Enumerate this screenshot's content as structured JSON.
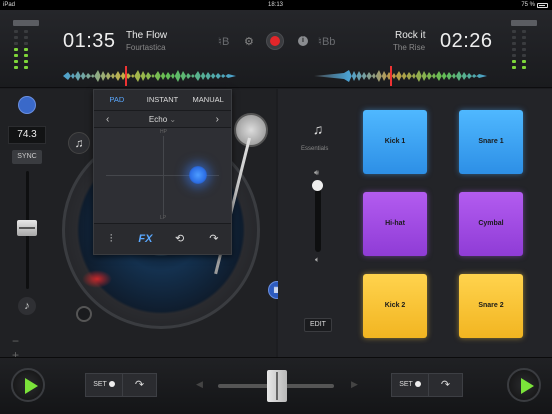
{
  "status": {
    "device": "iPad",
    "time": "18:13",
    "battery": "75 %"
  },
  "deck_a": {
    "time": "01:35",
    "title": "The Flow",
    "artist": "Fourtastica",
    "key": "B",
    "bpm": "74.3",
    "sync_label": "SYNC",
    "minus": "−",
    "plus": "+"
  },
  "deck_b": {
    "time": "02:26",
    "title": "Rock it",
    "artist": "The Rise",
    "key": "Bb"
  },
  "fx": {
    "tabs": [
      "PAD",
      "INSTANT",
      "MANUAL"
    ],
    "active_tab": "PAD",
    "effect": "Echo",
    "hp_label": "HP",
    "lp_label": "LP",
    "fx_label": "FX",
    "x_pos": 0.74,
    "y_pos": 0.5
  },
  "sampler": {
    "pack": "Essentials",
    "edit_label": "EDIT",
    "pads": [
      {
        "label": "Kick 1",
        "color": "#3fa9f5"
      },
      {
        "label": "Snare 1",
        "color": "#3fa9f5"
      },
      {
        "label": "Hi-hat",
        "color": "#a64fe8"
      },
      {
        "label": "Cymbal",
        "color": "#a64fe8"
      },
      {
        "label": "Kick 2",
        "color": "#fcc93a"
      },
      {
        "label": "Snare 2",
        "color": "#fcc93a"
      }
    ],
    "volume": 0.95
  },
  "bottom": {
    "set_left": "SET",
    "set_right": "SET",
    "crossfader": 0.5
  },
  "colors": {
    "accent": "#5aa8ff",
    "record": "#e3262a",
    "play": "#7be33a"
  }
}
